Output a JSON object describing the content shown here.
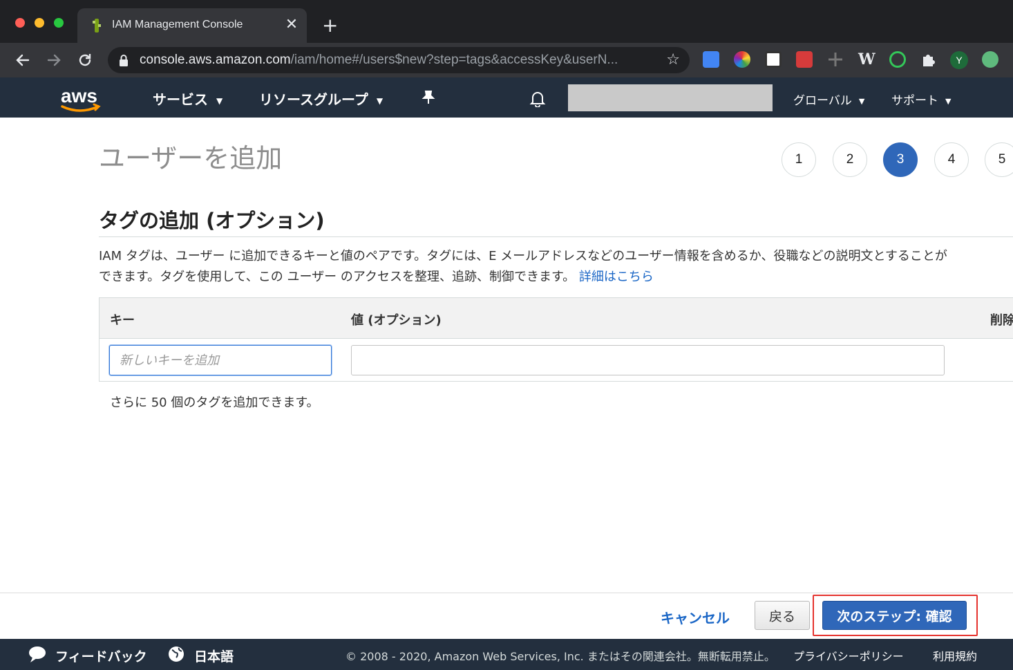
{
  "browser": {
    "tab_title": "IAM Management Console",
    "url_host": "console.aws.amazon.com",
    "url_path": "/iam/home#/users$new?step=tags&accessKey&userN...",
    "profile_initial": "Y"
  },
  "aws_nav": {
    "services": "サービス",
    "resource_groups": "リソースグループ",
    "region": "グローバル",
    "support": "サポート"
  },
  "page": {
    "title": "ユーザーを追加",
    "steps": [
      "1",
      "2",
      "3",
      "4",
      "5"
    ],
    "active_step": 3
  },
  "tags_section": {
    "title": "タグの追加 (オプション)",
    "description_1": "IAM タグは、ユーザー に追加できるキーと値のペアです。タグには、E メールアドレスなどのユーザー情報を含めるか、役職などの説明文とすることが",
    "description_2": "できます。タグを使用して、この ユーザー のアクセスを整理、追跡、制御できます。",
    "learn_more": "詳細はこちら",
    "col_key": "キー",
    "col_value": "値 (オプション)",
    "col_delete": "削除",
    "key_placeholder": "新しいキーを追加",
    "value_text": "",
    "remaining": "さらに 50 個のタグを追加できます。"
  },
  "actions": {
    "cancel": "キャンセル",
    "back": "戻る",
    "next": "次のステップ: 確認"
  },
  "footer": {
    "feedback": "フィードバック",
    "language": "日本語",
    "copyright": "© 2008 - 2020, Amazon Web Services, Inc. またはその関連会社。無断転用禁止。",
    "privacy": "プライバシーポリシー",
    "terms": "利用規約"
  },
  "colors": {
    "aws_nav_bg": "#232f3e",
    "primary_button": "#2f67b9",
    "link": "#1a66c6",
    "highlight_border": "#e5322d"
  }
}
